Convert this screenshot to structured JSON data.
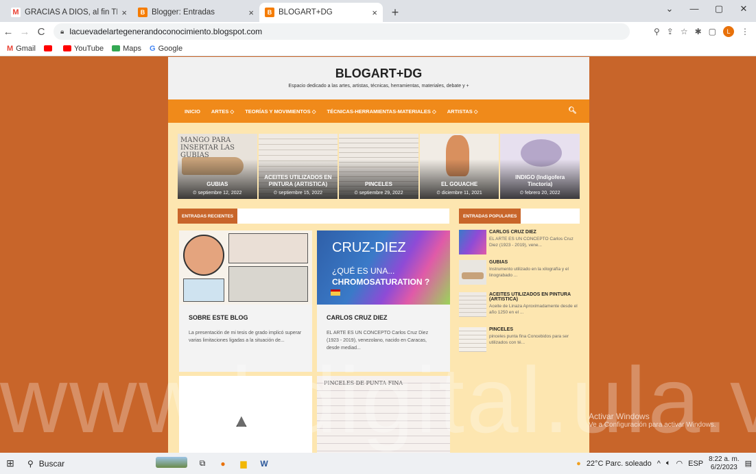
{
  "browser": {
    "tabs": [
      {
        "label": "GRACIAS A DIOS, al fin TDG LEL",
        "favicon": "gmail-icon",
        "close": "×"
      },
      {
        "label": "Blogger: Entradas",
        "favicon": "blogger-icon",
        "close": "×"
      },
      {
        "label": "BLOGART+DG",
        "favicon": "blogger-icon",
        "close": "×"
      }
    ],
    "new_tab": "+",
    "url": "lacuevadelartegenerandoconocimiento.blogspot.com",
    "avatar_letter": "L",
    "bookmarks": [
      {
        "label": "Gmail",
        "color": "#ea4335"
      },
      {
        "label": "",
        "color": "#ff0000"
      },
      {
        "label": "YouTube",
        "color": "#ff0000"
      },
      {
        "label": "Maps",
        "color": "#34a853"
      },
      {
        "label": "Google",
        "color": "#4285f4"
      }
    ],
    "window_controls": [
      "⌄",
      "—",
      "▢",
      "✕"
    ]
  },
  "site": {
    "title": "BLOGART+DG",
    "subtitle": "Espacio dedicado a las artes, artistas, técnicas, herramientas, materiales, debate y +",
    "nav": [
      "INICIO",
      "ARTES ◇",
      "TEORÍAS Y MOVIMIENTOS ◇",
      "TÉCNICAS-HERRAMIENTAS-MATERIALES ◇",
      "ARTISTAS ◇"
    ],
    "slides": [
      {
        "title": "GUBIAS",
        "date": "⏲ septiembre 12, 2022",
        "note": "MANGO PARA INSERTAR LAS GUBIAS"
      },
      {
        "title": "ACEITES UTILIZADOS EN PINTURA (ARTISTICA)",
        "date": "⏲ septiembre 15, 2022",
        "note": ""
      },
      {
        "title": "PINCELES",
        "date": "⏲ septiembre 29, 2022",
        "note": ""
      },
      {
        "title": "EL GOUACHE",
        "date": "⏲ diciembre 11, 2021",
        "note": ""
      },
      {
        "title": "INDIGO (Indigofera Tinctoria)",
        "date": "⏲ febrero 20, 2022",
        "note": ""
      }
    ],
    "recent_label": "ENTRADAS RECIENTES",
    "popular_label": "ENTRADAS POPULARES",
    "posts": [
      {
        "title": "SOBRE ESTE BLOG",
        "excerpt": "La presentación de mi tesis de grado implicó superar varias limitaciones ligadas a la situación de..."
      },
      {
        "title": "CARLOS CRUZ DIEZ",
        "excerpt": "EL ARTE ES UN CONCEPTO Carlos Cruz Diez (1923 - 2019), venezolano, nacido en Caracas, desde mediad...",
        "img_title": "CRUZ-DIEZ",
        "img_sub1": "¿QUÉ ES UNA...",
        "img_sub2": "CHROMOSATURATION ?"
      }
    ],
    "third_card_caption": "PINCELES DE PUNTA FINA",
    "popular": [
      {
        "title": "CARLOS CRUZ DIEZ",
        "excerpt": "EL ARTE ES UN CONCEPTO Carlos Cruz Diez (1923 - 2019), vene..."
      },
      {
        "title": "GUBIAS",
        "excerpt": "Instrumento utilizado en la xilografía y el linograbado ..."
      },
      {
        "title": "ACEITES UTILIZADOS EN PINTURA (ARTISTICA)",
        "excerpt": "Aceite de Linaza Aproximadamente desde el año 1250 en el ..."
      },
      {
        "title": "PINCELES",
        "excerpt": "pinceles punta fina Concebidos para ser utilizados con té..."
      }
    ]
  },
  "overlay": {
    "watermark": "www.bdigital.ula.ve",
    "activate_line1": "Activar Windows",
    "activate_line2": "Ve a Configuración para activar Windows."
  },
  "taskbar": {
    "search": "Buscar",
    "weather": "22°C  Parc. soleado",
    "lang": "ESP",
    "time": "8:22 a. m.",
    "date": "6/2/2023"
  }
}
